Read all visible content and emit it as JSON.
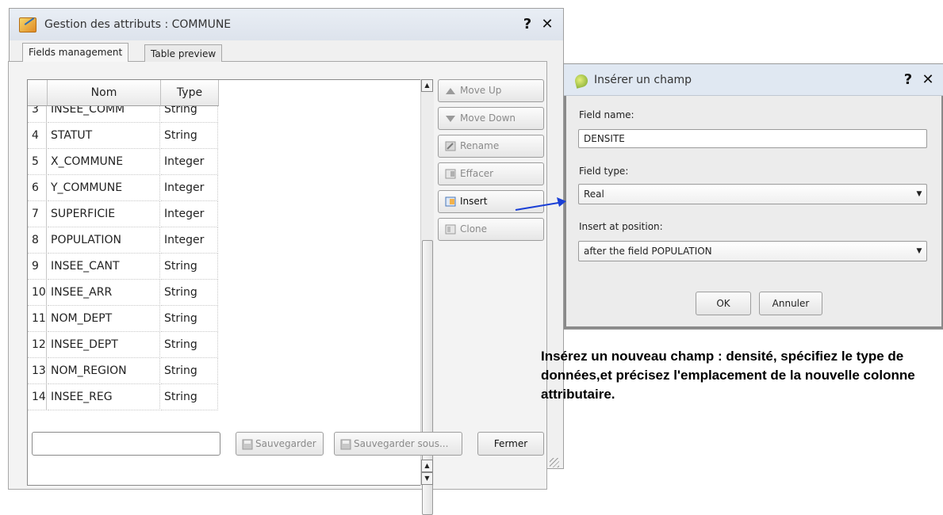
{
  "main_dialog": {
    "title": "Gestion des attributs : COMMUNE",
    "help_label": "?",
    "close_label": "✕",
    "tabs": [
      {
        "label": "Fields management"
      },
      {
        "label": "Table preview"
      }
    ],
    "table": {
      "headers": {
        "nom": "Nom",
        "type": "Type"
      },
      "rows": [
        {
          "n": "3",
          "nom": "INSEE_COMM",
          "type": "String"
        },
        {
          "n": "4",
          "nom": "STATUT",
          "type": "String"
        },
        {
          "n": "5",
          "nom": "X_COMMUNE",
          "type": "Integer"
        },
        {
          "n": "6",
          "nom": "Y_COMMUNE",
          "type": "Integer"
        },
        {
          "n": "7",
          "nom": "SUPERFICIE",
          "type": "Integer"
        },
        {
          "n": "8",
          "nom": "POPULATION",
          "type": "Integer"
        },
        {
          "n": "9",
          "nom": "INSEE_CANT",
          "type": "String"
        },
        {
          "n": "10",
          "nom": "INSEE_ARR",
          "type": "String"
        },
        {
          "n": "11",
          "nom": "NOM_DEPT",
          "type": "String"
        },
        {
          "n": "12",
          "nom": "INSEE_DEPT",
          "type": "String"
        },
        {
          "n": "13",
          "nom": "NOM_REGION",
          "type": "String"
        },
        {
          "n": "14",
          "nom": "INSEE_REG",
          "type": "String"
        }
      ]
    },
    "side_buttons": {
      "move_up": "Move Up",
      "move_down": "Move Down",
      "rename": "Rename",
      "effacer": "Effacer",
      "insert": "Insert",
      "clone": "Clone"
    },
    "bottom": {
      "input_value": "",
      "save": "Sauvegarder",
      "save_as": "Sauvegarder sous...",
      "close": "Fermer"
    }
  },
  "insert_dialog": {
    "title": "Insérer un champ",
    "help_label": "?",
    "close_label": "✕",
    "field_name_label": "Field name:",
    "field_name_value": "DENSITE",
    "field_type_label": "Field type:",
    "field_type_value": "Real",
    "position_label": "Insert at position:",
    "position_value": "after the field POPULATION",
    "ok": "OK",
    "cancel": "Annuler"
  },
  "caption": "Insérez un nouveau champ : densité, spécifiez le type de données,et précisez l'emplacement de la nouvelle colonne attributaire.",
  "colors": {
    "arrow": "#1a3fd6",
    "titlebar": "#dde3ec"
  }
}
